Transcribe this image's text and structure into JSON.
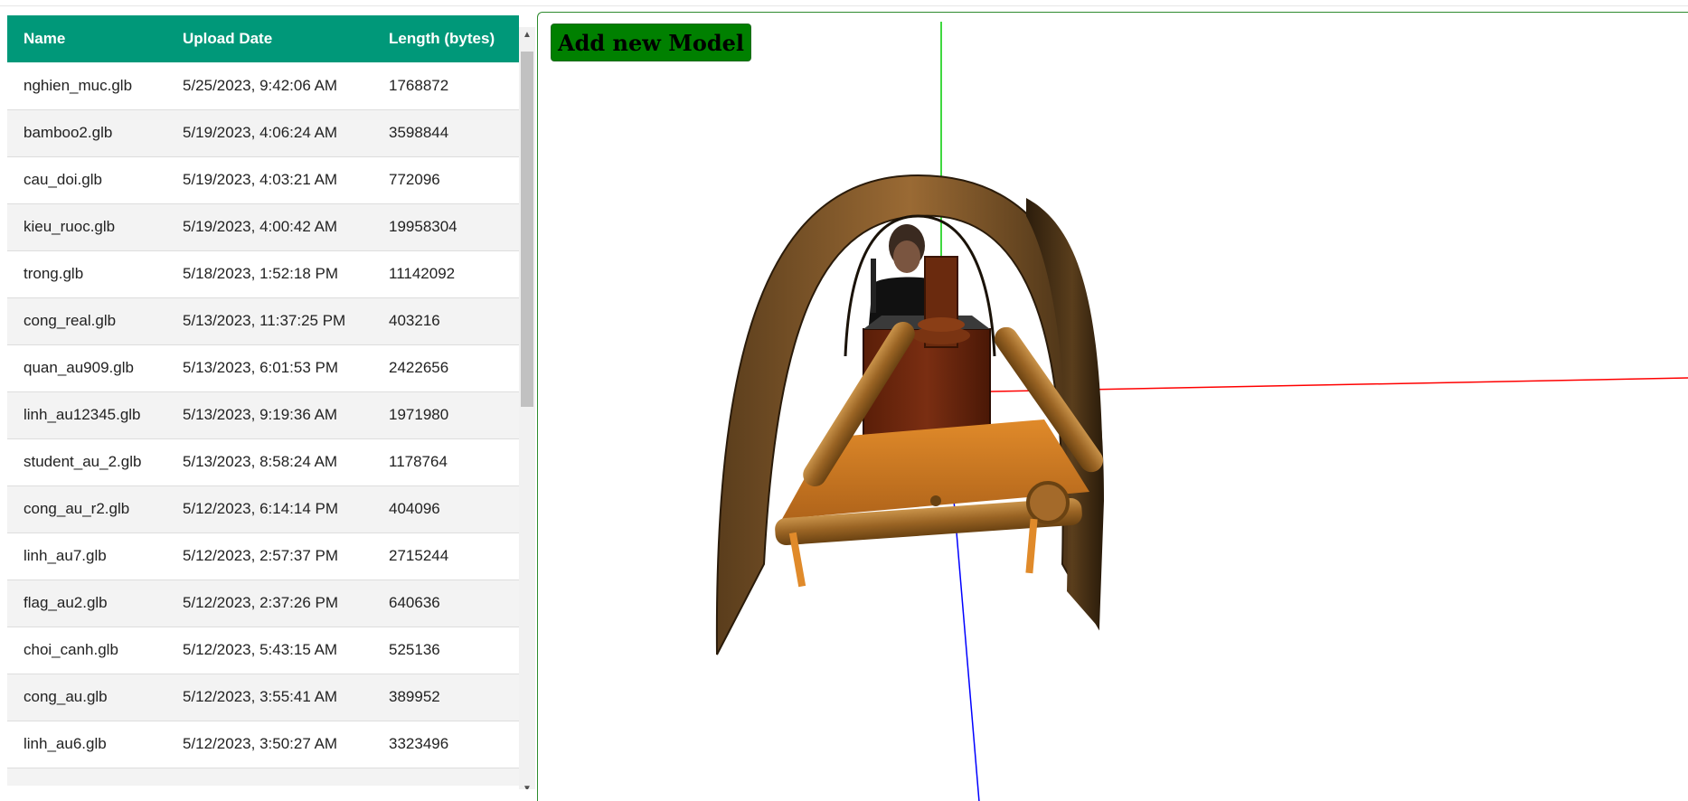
{
  "table": {
    "headers": {
      "name": "Name",
      "upload_date": "Upload Date",
      "length": "Length (bytes)"
    },
    "rows": [
      {
        "name": "nghien_muc.glb",
        "date": "5/25/2023, 9:42:06 AM",
        "length": "1768872"
      },
      {
        "name": "bamboo2.glb",
        "date": "5/19/2023, 4:06:24 AM",
        "length": "3598844"
      },
      {
        "name": "cau_doi.glb",
        "date": "5/19/2023, 4:03:21 AM",
        "length": "772096"
      },
      {
        "name": "kieu_ruoc.glb",
        "date": "5/19/2023, 4:00:42 AM",
        "length": "19958304"
      },
      {
        "name": "trong.glb",
        "date": "5/18/2023, 1:52:18 PM",
        "length": "11142092"
      },
      {
        "name": "cong_real.glb",
        "date": "5/13/2023, 11:37:25 PM",
        "length": "403216"
      },
      {
        "name": "quan_au909.glb",
        "date": "5/13/2023, 6:01:53 PM",
        "length": "2422656"
      },
      {
        "name": "linh_au12345.glb",
        "date": "5/13/2023, 9:19:36 AM",
        "length": "1971980"
      },
      {
        "name": "student_au_2.glb",
        "date": "5/13/2023, 8:58:24 AM",
        "length": "1178764"
      },
      {
        "name": "cong_au_r2.glb",
        "date": "5/12/2023, 6:14:14 PM",
        "length": "404096"
      },
      {
        "name": "linh_au7.glb",
        "date": "5/12/2023, 2:57:37 PM",
        "length": "2715244"
      },
      {
        "name": "flag_au2.glb",
        "date": "5/12/2023, 2:37:26 PM",
        "length": "640636"
      },
      {
        "name": "choi_canh.glb",
        "date": "5/12/2023, 5:43:15 AM",
        "length": "525136"
      },
      {
        "name": "cong_au.glb",
        "date": "5/12/2023, 3:55:41 AM",
        "length": "389952"
      },
      {
        "name": "linh_au6.glb",
        "date": "5/12/2023, 3:50:27 AM",
        "length": "3323496"
      },
      {
        "name": "",
        "date": "",
        "length": ""
      }
    ]
  },
  "viewer": {
    "add_button_label": "Add new Model",
    "axis_colors": {
      "x": "#ff0000",
      "y": "#00cc00",
      "z": "#0000ff"
    }
  },
  "colors": {
    "header_bg": "#009879",
    "button_bg": "#008000",
    "viewer_border": "#2e8b2e"
  },
  "scrollbar": {
    "up_icon": "arrow-up-icon",
    "down_icon": "arrow-down-icon"
  }
}
